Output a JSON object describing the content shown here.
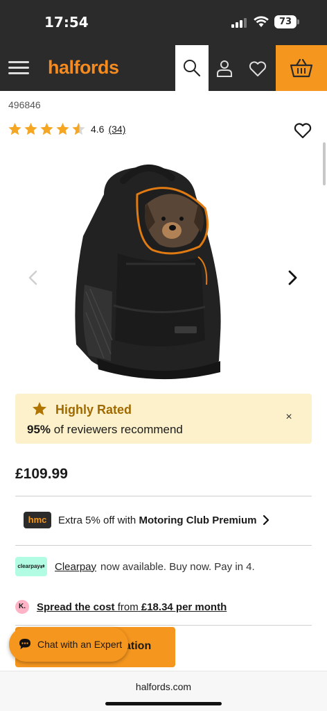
{
  "status_bar": {
    "time": "17:54",
    "battery": "73"
  },
  "nav": {
    "logo": "halfords"
  },
  "product": {
    "sku": "496846",
    "rating": "4.6",
    "rating_stars": 4.5,
    "review_count": "(34)",
    "price": "£109.99"
  },
  "highly_rated": {
    "title": "Highly Rated",
    "percent": "95%",
    "text": "of reviewers recommend",
    "close": "×"
  },
  "hmc": {
    "badge": "hmc",
    "text_prefix": "Extra 5% off with",
    "text_bold": "Motoring Club Premium"
  },
  "clearpay": {
    "badge": "clearpay⇄",
    "link": "Clearpay",
    "text": "now available. Buy now. Pay in 4."
  },
  "klarna": {
    "badge": "K.",
    "lead": "Spread the cost",
    "from": "from",
    "amount": "£18.34 per month"
  },
  "cta": {
    "label_visible": "ation"
  },
  "chat": {
    "label": "Chat with an Expert"
  },
  "browser": {
    "url": "halfords.com"
  },
  "icons": [
    "menu-icon",
    "search-icon",
    "account-icon",
    "heart-icon",
    "basket-icon",
    "chevron-left-icon",
    "chevron-right-icon",
    "star-icon",
    "close-icon",
    "chat-icon"
  ],
  "colors": {
    "brand_orange": "#f5961e",
    "nav_dark": "#2b2b2b",
    "rated_bg": "#fdf1cc",
    "rated_title": "#a06a00",
    "clearpay_mint": "#b2fce4",
    "klarna_pink": "#ffb3c7"
  }
}
